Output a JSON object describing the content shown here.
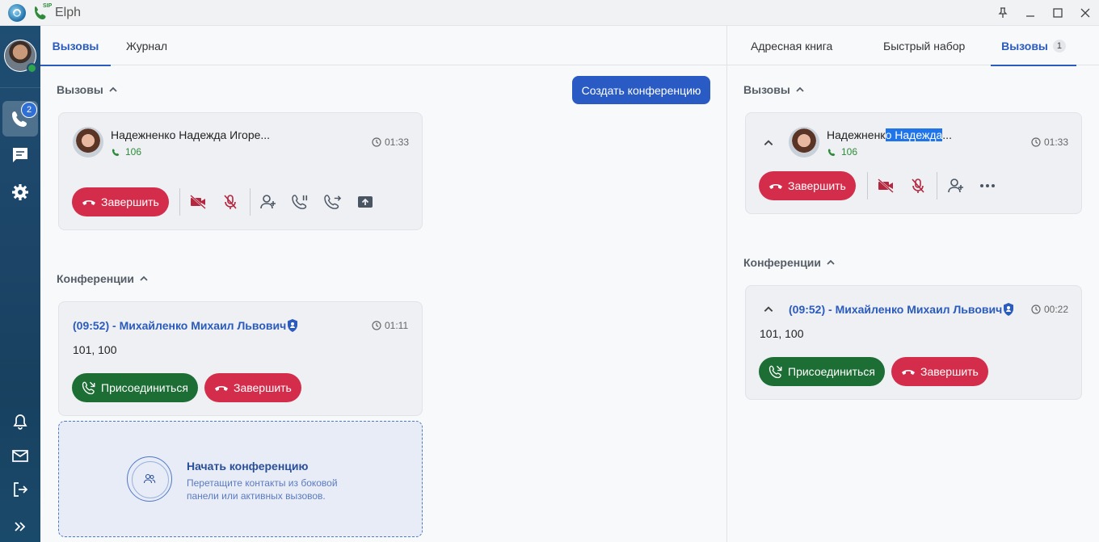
{
  "app": {
    "title": "Elph",
    "sip_label": "SIP"
  },
  "rail": {
    "calls_badge": "2"
  },
  "main": {
    "tabs": [
      {
        "label": "Вызовы"
      },
      {
        "label": "Журнал"
      }
    ],
    "calls_section": "Вызовы",
    "create_conference": "Создать конференцию",
    "call": {
      "name": "Надежненко Надежда Игоре...",
      "ext": "106",
      "timer": "01:33",
      "end_label": "Завершить"
    },
    "conferences_section": "Конференции",
    "conference": {
      "title": "(09:52) - Михайленко Михаил Львович",
      "members": "101, 100",
      "timer": "01:11",
      "join_label": "Присоединиться",
      "end_label": "Завершить"
    },
    "dropzone": {
      "title": "Начать конференцию",
      "subtitle": "Перетащите контакты из боковой панели или активных вызовов."
    }
  },
  "side": {
    "tabs": [
      {
        "label": "Адресная книга"
      },
      {
        "label": "Быстрый набор"
      },
      {
        "label": "Вызовы",
        "count": "1"
      }
    ],
    "calls_section": "Вызовы",
    "call": {
      "name_prefix": "Надежненк",
      "name_selected": "о Надежда",
      "name_suffix": "...",
      "ext": "106",
      "timer": "01:33",
      "end_label": "Завершить"
    },
    "conferences_section": "Конференции",
    "conference": {
      "title": "(09:52) - Михайленко Михаил Львович",
      "members": "101, 100",
      "timer": "00:22",
      "join_label": "Присоединиться",
      "end_label": "Завершить"
    }
  }
}
